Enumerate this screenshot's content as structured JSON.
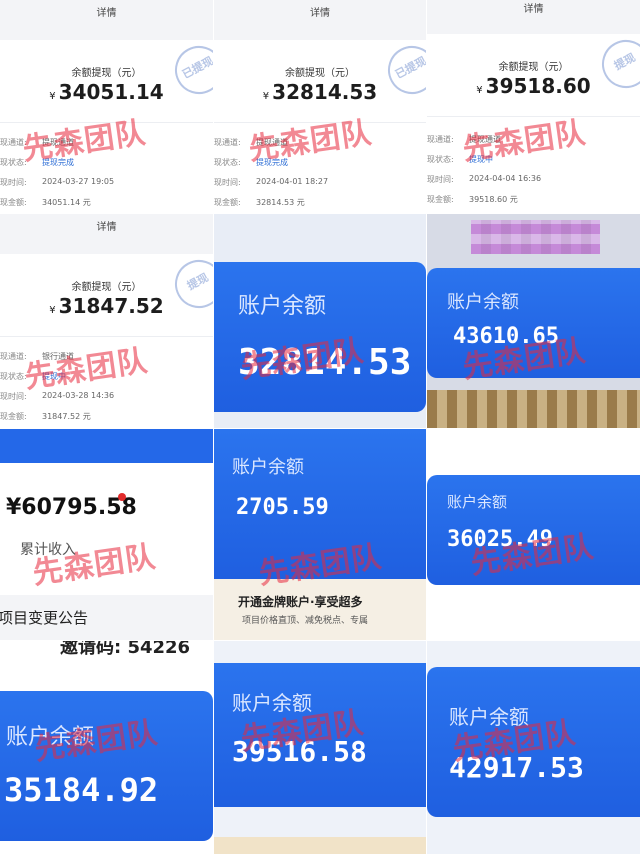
{
  "watermark": "先森团队",
  "colors": {
    "accent_blue": "#2468e8",
    "watermark_red": "#e8283c",
    "link_blue": "#2f6fd6"
  },
  "details": [
    {
      "title": "详情",
      "label": "余额提现（元）",
      "currency": "¥",
      "amount": "34051.14",
      "rows": [
        {
          "key": "现通道:",
          "value": "提现通道"
        },
        {
          "key": "现状态:",
          "value": "提现完成"
        },
        {
          "key": "现时间:",
          "value": "2024-03-27 19:05"
        },
        {
          "key": "现金额:",
          "value": "34051.14 元"
        }
      ],
      "stamp": "已提现"
    },
    {
      "title": "详情",
      "label": "余额提现（元）",
      "currency": "¥",
      "amount": "32814.53",
      "rows": [
        {
          "key": "现通道:",
          "value": "提现通道"
        },
        {
          "key": "现状态:",
          "value": "提现完成"
        },
        {
          "key": "现时间:",
          "value": "2024-04-01 18:27"
        },
        {
          "key": "现金额:",
          "value": "32814.53 元"
        }
      ],
      "stamp": "已提现"
    },
    {
      "title": "详情",
      "label": "余额提现（元）",
      "currency": "¥",
      "amount": "39518.60",
      "rows": [
        {
          "key": "现通道:",
          "value": "提现通道"
        },
        {
          "key": "现状态:",
          "value": "提现中"
        },
        {
          "key": "现时间:",
          "value": "2024-04-04 16:36"
        },
        {
          "key": "现金额:",
          "value": "39518.60 元"
        }
      ],
      "stamp": "提现"
    },
    {
      "title": "详情",
      "label": "余额提现（元）",
      "currency": "¥",
      "amount": "31847.52",
      "rows": [
        {
          "key": "现通道:",
          "value": "银行通道"
        },
        {
          "key": "现状态:",
          "value": "提现中"
        },
        {
          "key": "现时间:",
          "value": "2024-03-28 14:36"
        },
        {
          "key": "现金额:",
          "value": "31847.52 元"
        }
      ],
      "stamp": "提现"
    }
  ],
  "balances": {
    "label": "账户余额",
    "b1": "32814.53",
    "b2": "43610.65",
    "b3": "2705.59",
    "b4": "36025.49",
    "b5": "35184.92",
    "b6": "39516.58",
    "b7": "42917.53"
  },
  "income": {
    "amount": "¥60795.58",
    "label": "累计收入",
    "notice": "项目变更公告",
    "invite": "邀请码: 54226"
  },
  "promo": {
    "headline": "开通金牌账户·享受超多",
    "sub": "项目价格直顶、减免税点、专属"
  }
}
